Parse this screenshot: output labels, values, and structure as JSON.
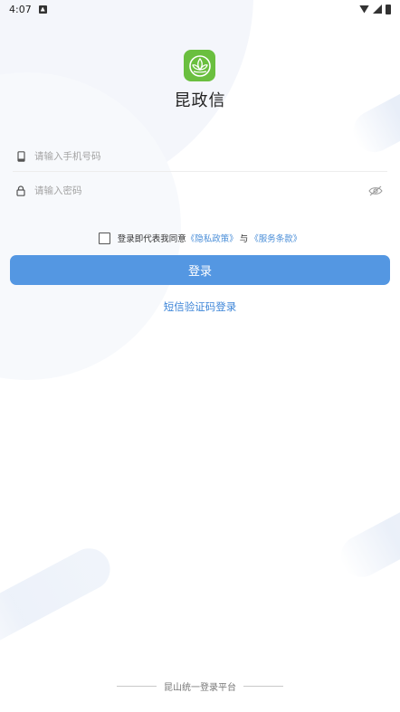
{
  "status_bar": {
    "time": "4:07",
    "icons": [
      "notification-icon",
      "wifi-icon",
      "signal-icon",
      "battery-icon"
    ]
  },
  "app": {
    "title": "昆政信",
    "logo_icon": "lotus-logo-icon",
    "logo_color": "#6abf3f"
  },
  "form": {
    "phone": {
      "value": "",
      "placeholder": "请输入手机号码",
      "icon": "phone-icon"
    },
    "password": {
      "value": "",
      "placeholder": "请输入密码",
      "icon": "lock-icon",
      "toggle_icon": "eye-off-icon"
    }
  },
  "agreement": {
    "prefix": "登录即代表我同意",
    "privacy_link": "《隐私政策》",
    "conjunction": "与",
    "terms_link": "《服务条款》",
    "checked": false
  },
  "login_button": {
    "label": "登录",
    "color": "#5497e2"
  },
  "sms_login": {
    "label": "短信验证码登录",
    "color": "#3e86d8"
  },
  "footer": {
    "text": "昆山统一登录平台"
  }
}
